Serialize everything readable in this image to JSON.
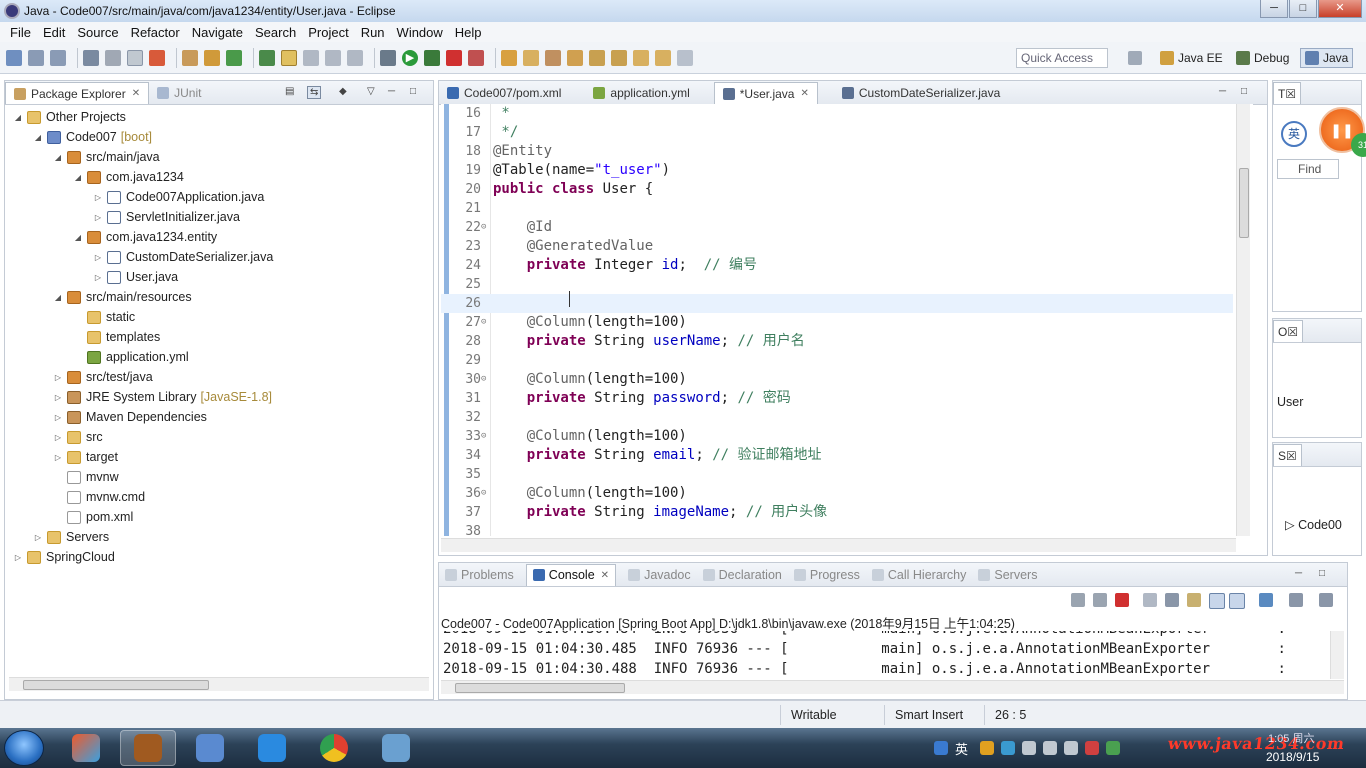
{
  "window": {
    "title": "Java - Code007/src/main/java/com/java1234/entity/User.java - Eclipse"
  },
  "menu": [
    "File",
    "Edit",
    "Source",
    "Refactor",
    "Navigate",
    "Search",
    "Project",
    "Run",
    "Window",
    "Help"
  ],
  "toolbar": {
    "quick_access_placeholder": "Quick Access"
  },
  "perspectives": [
    "Java EE",
    "Debug",
    "Java"
  ],
  "package_explorer": {
    "tabs": [
      "Package Explorer",
      "JUnit"
    ],
    "tree": [
      {
        "label": "Other Projects",
        "indent": 0,
        "arrow": "◢",
        "icon": "folder"
      },
      {
        "label": "Code007",
        "suffix": "[boot]",
        "indent": 1,
        "arrow": "◢",
        "icon": "proj"
      },
      {
        "label": "src/main/java",
        "indent": 2,
        "arrow": "◢",
        "icon": "pkg"
      },
      {
        "label": "com.java1234",
        "indent": 3,
        "arrow": "◢",
        "icon": "pkg"
      },
      {
        "label": "Code007Application.java",
        "indent": 4,
        "arrow": "▷",
        "icon": "jfile"
      },
      {
        "label": "ServletInitializer.java",
        "indent": 4,
        "arrow": "▷",
        "icon": "jfile"
      },
      {
        "label": "com.java1234.entity",
        "indent": 3,
        "arrow": "◢",
        "icon": "pkg"
      },
      {
        "label": "CustomDateSerializer.java",
        "indent": 4,
        "arrow": "▷",
        "icon": "jfile"
      },
      {
        "label": "User.java",
        "indent": 4,
        "arrow": "▷",
        "icon": "jfile"
      },
      {
        "label": "src/main/resources",
        "indent": 2,
        "arrow": "◢",
        "icon": "pkg"
      },
      {
        "label": "static",
        "indent": 3,
        "arrow": "",
        "icon": "folder"
      },
      {
        "label": "templates",
        "indent": 3,
        "arrow": "",
        "icon": "folder"
      },
      {
        "label": "application.yml",
        "indent": 3,
        "arrow": "",
        "icon": "yml"
      },
      {
        "label": "src/test/java",
        "indent": 2,
        "arrow": "▷",
        "icon": "pkg"
      },
      {
        "label": "JRE System Library",
        "suffix": "[JavaSE-1.8]",
        "indent": 2,
        "arrow": "▷",
        "icon": "lib"
      },
      {
        "label": "Maven Dependencies",
        "indent": 2,
        "arrow": "▷",
        "icon": "lib"
      },
      {
        "label": "src",
        "indent": 2,
        "arrow": "▷",
        "icon": "folder"
      },
      {
        "label": "target",
        "indent": 2,
        "arrow": "▷",
        "icon": "folder"
      },
      {
        "label": "mvnw",
        "indent": 2,
        "arrow": "",
        "icon": "file"
      },
      {
        "label": "mvnw.cmd",
        "indent": 2,
        "arrow": "",
        "icon": "file"
      },
      {
        "label": "pom.xml",
        "indent": 2,
        "arrow": "",
        "icon": "file"
      },
      {
        "label": "Servers",
        "indent": 1,
        "arrow": "▷",
        "icon": "folder"
      },
      {
        "label": "SpringCloud",
        "indent": 0,
        "arrow": "▷",
        "icon": "folder"
      }
    ]
  },
  "editor": {
    "tabs": [
      {
        "label": "Code007/pom.xml",
        "active": false
      },
      {
        "label": "application.yml",
        "active": false
      },
      {
        "label": "*User.java",
        "active": true
      },
      {
        "label": "CustomDateSerializer.java",
        "active": false
      }
    ],
    "current_line": 26,
    "lines": [
      {
        "n": "16",
        "parts": [
          {
            "t": " *",
            "c": "cmt"
          }
        ]
      },
      {
        "n": "17",
        "parts": [
          {
            "t": " */",
            "c": "cmt"
          }
        ]
      },
      {
        "n": "18",
        "parts": [
          {
            "t": "@Entity",
            "c": "ann"
          }
        ]
      },
      {
        "n": "19",
        "parts": [
          {
            "t": "@Table(name=",
            "c": ""
          },
          {
            "t": "\"t_user\"",
            "c": "str"
          },
          {
            "t": ")",
            "c": ""
          }
        ]
      },
      {
        "n": "20",
        "parts": [
          {
            "t": "public class",
            "c": "kw"
          },
          {
            "t": " User {",
            "c": ""
          }
        ]
      },
      {
        "n": "21",
        "parts": []
      },
      {
        "n": "22",
        "fold": true,
        "parts": [
          {
            "t": "    @Id",
            "c": "ann"
          }
        ]
      },
      {
        "n": "23",
        "parts": [
          {
            "t": "    @GeneratedValue",
            "c": "ann"
          }
        ]
      },
      {
        "n": "24",
        "parts": [
          {
            "t": "    ",
            "c": ""
          },
          {
            "t": "private",
            "c": "kw"
          },
          {
            "t": " Integer ",
            "c": ""
          },
          {
            "t": "id",
            "c": "fld"
          },
          {
            "t": ";  ",
            "c": ""
          },
          {
            "t": "// 编号",
            "c": "cmt"
          }
        ]
      },
      {
        "n": "25",
        "parts": []
      },
      {
        "n": "26",
        "parts": []
      },
      {
        "n": "27",
        "fold": true,
        "parts": [
          {
            "t": "    @Column",
            "c": "ann"
          },
          {
            "t": "(length=100)",
            "c": ""
          }
        ]
      },
      {
        "n": "28",
        "parts": [
          {
            "t": "    ",
            "c": ""
          },
          {
            "t": "private",
            "c": "kw"
          },
          {
            "t": " String ",
            "c": ""
          },
          {
            "t": "userName",
            "c": "fld"
          },
          {
            "t": "; ",
            "c": ""
          },
          {
            "t": "// 用户名",
            "c": "cmt"
          }
        ]
      },
      {
        "n": "29",
        "parts": []
      },
      {
        "n": "30",
        "fold": true,
        "parts": [
          {
            "t": "    @Column",
            "c": "ann"
          },
          {
            "t": "(length=100)",
            "c": ""
          }
        ]
      },
      {
        "n": "31",
        "parts": [
          {
            "t": "    ",
            "c": ""
          },
          {
            "t": "private",
            "c": "kw"
          },
          {
            "t": " String ",
            "c": ""
          },
          {
            "t": "password",
            "c": "fld"
          },
          {
            "t": "; ",
            "c": ""
          },
          {
            "t": "// 密码",
            "c": "cmt"
          }
        ]
      },
      {
        "n": "32",
        "parts": []
      },
      {
        "n": "33",
        "fold": true,
        "parts": [
          {
            "t": "    @Column",
            "c": "ann"
          },
          {
            "t": "(length=100)",
            "c": ""
          }
        ]
      },
      {
        "n": "34",
        "parts": [
          {
            "t": "    ",
            "c": ""
          },
          {
            "t": "private",
            "c": "kw"
          },
          {
            "t": " String ",
            "c": ""
          },
          {
            "t": "email",
            "c": "fld"
          },
          {
            "t": "; ",
            "c": ""
          },
          {
            "t": "// 验证邮箱地址",
            "c": "cmt"
          }
        ]
      },
      {
        "n": "35",
        "parts": []
      },
      {
        "n": "36",
        "fold": true,
        "parts": [
          {
            "t": "    @Column",
            "c": "ann"
          },
          {
            "t": "(length=100)",
            "c": ""
          }
        ]
      },
      {
        "n": "37",
        "parts": [
          {
            "t": "    ",
            "c": ""
          },
          {
            "t": "private",
            "c": "kw"
          },
          {
            "t": " String ",
            "c": ""
          },
          {
            "t": "imageName",
            "c": "fld"
          },
          {
            "t": "; ",
            "c": ""
          },
          {
            "t": "// 用户头像",
            "c": "cmt"
          }
        ]
      },
      {
        "n": "38",
        "parts": []
      }
    ]
  },
  "bottom": {
    "tabs": [
      "Problems",
      "Console",
      "Javadoc",
      "Declaration",
      "Progress",
      "Call Hierarchy",
      "Servers"
    ],
    "active_tab": "Console",
    "console_header": "Code007 - Code007Application [Spring Boot App] D:\\jdk1.8\\bin\\javaw.exe (2018年9月15日 上午1:04:25)",
    "lines": [
      "2018-09-15 01:04:30.484  INFO 76936 --- [           main] o.s.j.e.a.AnnotationMBeanExporter        :",
      "2018-09-15 01:04:30.485  INFO 76936 --- [           main] o.s.j.e.a.AnnotationMBeanExporter        :",
      "2018-09-15 01:04:30.488  INFO 76936 --- [           main] o.s.j.e.a.AnnotationMBeanExporter        :"
    ]
  },
  "right_panels": {
    "task_tab": "T☒",
    "ime_label": "英",
    "find_placeholder": "Find",
    "outline_tab": "O☒",
    "outline_item": "User",
    "servers_tab": "S☒",
    "servers_item": "Code00",
    "badge": "31"
  },
  "status": {
    "writable": "Writable",
    "insert_mode": "Smart Insert",
    "position": "26 : 5"
  },
  "taskbar": {
    "ime": "英",
    "watermark": "www.java1234.com",
    "time": "1:05 周六",
    "date": "2018/9/15"
  }
}
